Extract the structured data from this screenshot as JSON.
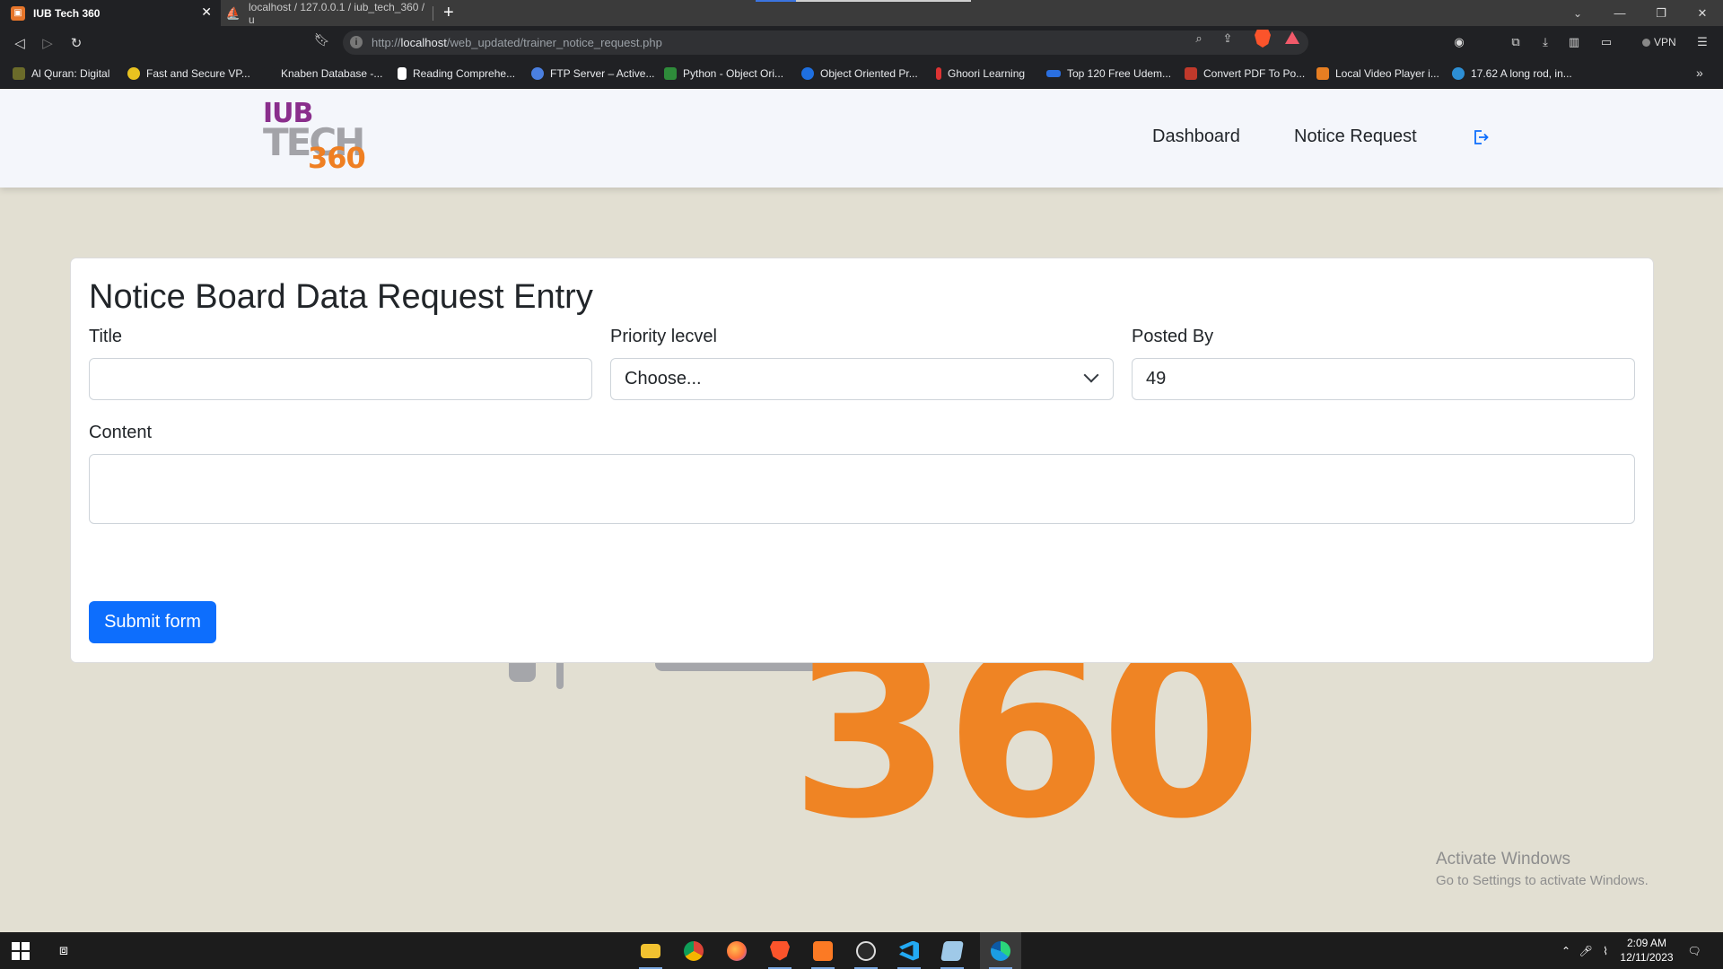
{
  "browser": {
    "tabs": [
      {
        "title": "IUB Tech 360",
        "active": true
      },
      {
        "title": "localhost / 127.0.0.1 / iub_tech_360 / u",
        "active": false
      }
    ],
    "url_scheme": "http://",
    "url_host": "localhost",
    "url_path": "/web_updated/trainer_notice_request.php",
    "vpn_label": "VPN",
    "bookmarks": [
      {
        "label": "Al Quran: Digital",
        "color": "#6b6b2a"
      },
      {
        "label": "Fast and Secure VP...",
        "color": "#e8c220"
      },
      {
        "label": "Knaben Database -...",
        "color": "#202124"
      },
      {
        "label": "Reading Comprehe...",
        "color": "#ffffff"
      },
      {
        "label": "FTP Server – Active...",
        "color": "#4a7fe0"
      },
      {
        "label": "Python - Object Ori...",
        "color": "#2e8b3a"
      },
      {
        "label": "Object Oriented Pr...",
        "color": "#1e6fe0"
      },
      {
        "label": "Ghoori Learning",
        "color": "#d33"
      },
      {
        "label": "Top 120 Free Udem...",
        "color": "#2a6fe0"
      },
      {
        "label": "Convert PDF To Po...",
        "color": "#c0392b"
      },
      {
        "label": "Local Video Player i...",
        "color": "#e67e22"
      },
      {
        "label": "17.62 A long rod, in...",
        "color": "#2d8fd5"
      }
    ]
  },
  "site": {
    "logo_line1": "IUB",
    "logo_line2": "TECH",
    "logo_line3": "360",
    "nav": {
      "dashboard": "Dashboard",
      "notice_request": "Notice Request"
    },
    "colors": {
      "accent": "#0d6efd",
      "brand_orange": "#ef7f22",
      "brand_purple": "#8a2e8c"
    }
  },
  "form": {
    "heading": "Notice Board Data Request Entry",
    "title_label": "Title",
    "title_value": "",
    "priority_label": "Priority lecvel",
    "priority_selected": "Choose...",
    "posted_by_label": "Posted By",
    "posted_by_value": "49",
    "content_label": "Content",
    "content_value": "",
    "submit_label": "Submit form"
  },
  "background_watermark": "360",
  "os": {
    "activate_title": "Activate Windows",
    "activate_sub": "Go to Settings to activate Windows.",
    "time": "2:09 AM",
    "date": "12/11/2023"
  }
}
